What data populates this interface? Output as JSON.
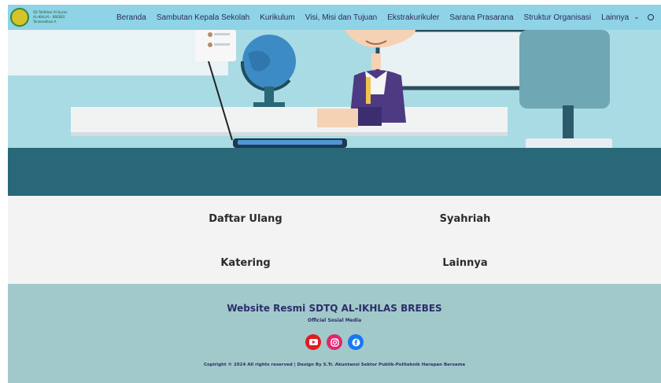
{
  "logo": {
    "line1": "SD Tahfidzul Al-Quran",
    "line2": "AL-IKHLAS - BREBES",
    "line3": "Terakreditasi A"
  },
  "nav": {
    "items": [
      "Beranda",
      "Sambutan Kepala Sekolah",
      "Kurikulum",
      "Visi, Misi dan Tujuan",
      "Ekstrakurikuler",
      "Sarana Prasarana",
      "Struktur Organisasi",
      "Lainnya"
    ],
    "more_icon": "chevron-down-icon",
    "search_icon": "search-icon"
  },
  "menu": {
    "items": [
      "Daftar Ulang",
      "Syahriah",
      "Katering",
      "Lainnya"
    ]
  },
  "footer": {
    "title": "Website Resmi SDTQ AL-IKHLAS BREBES",
    "subtitle": "Official Sosial Media",
    "social_icons": [
      "youtube-icon",
      "instagram-icon",
      "facebook-icon"
    ],
    "copyright": "Copiright © 2024 All rights reserved | Design By S.Tr. Akuntansi Sektor Publik-Politeknik Harapan Bersama"
  },
  "colors": {
    "nav_bg": "#8fd3e6",
    "hero_bg": "#a9dbe4",
    "hero_floor": "#296878",
    "menu_bg": "#f3f3f3",
    "footer_bg": "#a1c9c9",
    "text_dark": "#2d2d6e"
  }
}
